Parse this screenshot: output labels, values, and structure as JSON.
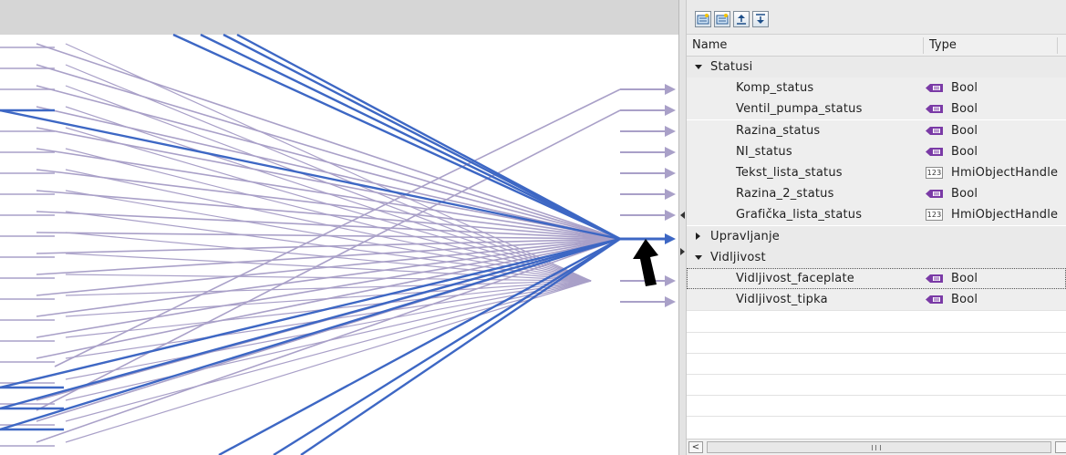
{
  "colors": {
    "line_light": "#a9a0c8",
    "line_highlight": "#3d67c4",
    "cursor": "#000000",
    "panel_bg": "#ffffff",
    "row_bg": "#eeeeee"
  },
  "canvas": {
    "cursor_icon": "up-arrow-cursor-icon"
  },
  "panel": {
    "toolbar": {
      "buttons": [
        {
          "name": "add-tag-icon"
        },
        {
          "name": "add-struct-icon"
        },
        {
          "name": "move-up-icon"
        },
        {
          "name": "move-down-icon"
        }
      ]
    },
    "header": {
      "name_label": "Name",
      "type_label": "Type"
    },
    "groups": [
      {
        "label": "Statusi",
        "expanded": true,
        "items": [
          {
            "name": "Komp_status",
            "type": "Bool",
            "type_icon": "bool-icon"
          },
          {
            "name": "Ventil_pumpa_status",
            "type": "Bool",
            "type_icon": "bool-icon"
          },
          {
            "name": "Razina_status",
            "type": "Bool",
            "type_icon": "bool-icon"
          },
          {
            "name": "NI_status",
            "type": "Bool",
            "type_icon": "bool-icon"
          },
          {
            "name": "Tekst_lista_status",
            "type": "HmiObjectHandle",
            "type_icon": "int-icon",
            "icon_text": "123"
          },
          {
            "name": "Razina_2_status",
            "type": "Bool",
            "type_icon": "bool-icon"
          },
          {
            "name": "Grafička_lista_status",
            "type": "HmiObjectHandle",
            "type_icon": "int-icon",
            "icon_text": "123"
          }
        ]
      },
      {
        "label": "Upravljanje",
        "expanded": false,
        "items": []
      },
      {
        "label": "Vidljivost",
        "expanded": true,
        "items": [
          {
            "name": "Vidljivost_faceplate",
            "type": "Bool",
            "type_icon": "bool-icon",
            "selected": true
          },
          {
            "name": "Vidljivost_tipka",
            "type": "Bool",
            "type_icon": "bool-icon"
          }
        ]
      }
    ],
    "scrollbar": {
      "left_arrow": "<",
      "grip": "III"
    }
  }
}
